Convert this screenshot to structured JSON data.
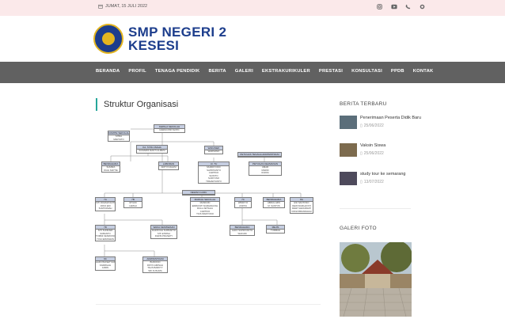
{
  "topbar": {
    "date": "JUMAT, 15 JULI 2022",
    "icons": [
      "instagram-icon",
      "youtube-icon",
      "phone-icon",
      "whatsapp-icon"
    ]
  },
  "brand": {
    "line1": "SMP NEGERI 2",
    "line2": "KESESI",
    "color": "#1c3d8c"
  },
  "nav": {
    "items": [
      "BERANDA",
      "PROFIL",
      "TENAGA PENDIDIK",
      "BERITA",
      "GALERI",
      "EKSTRAKURIKULER",
      "PRESTASI",
      "KONSULTASI",
      "PPDB",
      "KONTAK"
    ]
  },
  "main": {
    "title": "Struktur Organisasi"
  },
  "org": {
    "head": {
      "title": "KEPALA SEKOLAH",
      "name": "DARNO PRIYANTO"
    },
    "komite": {
      "title": "KOMITE SEKOLAH",
      "names": [
        "SITRA",
        "MARYATO"
      ]
    },
    "ka_tu": {
      "title": "KA. TATA USAHA",
      "name": "SUMARDI MANTI ALMESI"
    },
    "wakasek": {
      "title": "WAKASEK",
      "name": "WARSONO"
    },
    "petugas": {
      "title": "PETUGAS TENAGA ADMINISTRASI"
    },
    "bendahara": {
      "title": "BENDAHARA",
      "names": [
        "SUMIRA",
        "DIAH SAPTIE"
      ]
    },
    "laboran": {
      "title": "LABORAN",
      "name": "ADITYA DALIM"
    },
    "urusan": {
      "title": "Ur. TU",
      "names": [
        "MURDIYONO",
        "SAPRIYANTO",
        "CARTIKO",
        "SUWITO",
        "SURYONO",
        "TRIHARYANTO"
      ]
    },
    "satpam": {
      "title": "PETUGAS KEAMANAN",
      "names": [
        "UMAR",
        "MARDI",
        "RUKIM"
      ]
    },
    "guru": {
      "title": "DEWAN GURU"
    },
    "g1": {
      "title": "7A",
      "names": [
        "SITI ROHMAYANTI",
        "JOKO EDI",
        "SUMIYAMAH"
      ]
    },
    "g2": {
      "title": "7B",
      "names": [
        "RIYANI",
        "LEMAH"
      ]
    },
    "g3": {
      "title": "MARIAH SEKOLAH",
      "names": [
        "MASDUKI",
        "ERMAYATI NURHIDAYAH",
        "RULLI ARTALIA",
        "CARTIKO",
        "TIUS WARYONO"
      ]
    },
    "g4": {
      "title": "7C",
      "names": [
        "WINDIYO",
        "ASRIYA"
      ]
    },
    "g5": {
      "title": "BENDAHARA",
      "names": [
        "ABDUL AZIS",
        "M. SANTOS"
      ]
    },
    "g6": {
      "title": "8A",
      "names": [
        "ESI SANTOSO",
        "DEWI NURHAYATI",
        "DEWI SARASWATI",
        "NONA BRANDHAGI"
      ]
    },
    "g7": {
      "title": "7D",
      "names": [
        "SITI SUNDARI",
        "SUBANTO",
        "TOMMI KESRIONO",
        "YOGI ERMAWAN"
      ]
    },
    "g8": {
      "title": "WAKA KESISWAAN",
      "names": [
        "DARISYAH SUPRAPTO",
        "SITI ETRINA",
        "DARIS PRASETY"
      ]
    },
    "g9": {
      "title": "BENDAHARA",
      "names": [
        "ALDO SUPRIYANTO",
        "WAKURI"
      ]
    },
    "g10": {
      "title": "MEJIS",
      "names": [
        "TURMAH"
      ]
    },
    "g11": {
      "title": "9C",
      "names": [
        "HARI PRASETYAWATI",
        "KARMILAH",
        "JAMIN"
      ]
    },
    "g12": {
      "title": "ADMINISTRASI",
      "names": [
        "BUDIONO",
        "RIFYN AMINAH",
        "TALIS BARKTY",
        "SRI KUSUMA"
      ]
    }
  },
  "sidebar": {
    "news_title": "BERITA TERBARU",
    "posts": [
      {
        "title": "Penerimaan Peserta Didik Baru",
        "date": "25/06/2022"
      },
      {
        "title": "Vaksin Siswa",
        "date": "25/06/2022"
      },
      {
        "title": "study tour ke semarang",
        "date": "13/07/2022"
      }
    ],
    "gallery_title": "GALERI FOTO"
  },
  "colors": {
    "nav_bg": "#616161",
    "topbar_bg": "#fbe9ea",
    "accent": "#26a69a"
  }
}
